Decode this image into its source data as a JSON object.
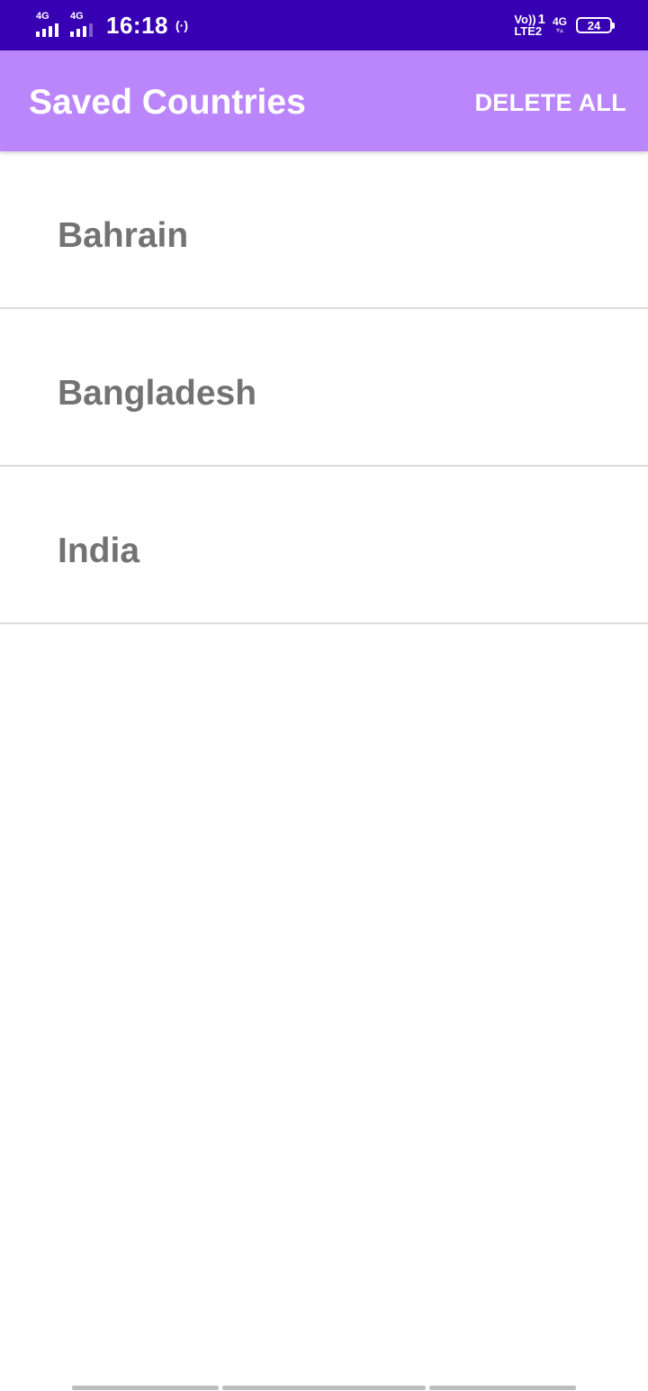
{
  "status_bar": {
    "sim1_network": "4G",
    "sim2_network": "4G",
    "time": "16:18",
    "hotspot_icon": "(·)",
    "volte_label": "Vo))",
    "volte_sim": "1",
    "lte_label": "LTE2",
    "mobile_data_network": "4G",
    "battery_level": "24"
  },
  "app_bar": {
    "title": "Saved Countries",
    "delete_all_label": "DELETE ALL",
    "background_color": "#bb86fc"
  },
  "countries": [
    {
      "name": "Bahrain"
    },
    {
      "name": "Bangladesh"
    },
    {
      "name": "India"
    }
  ],
  "colors": {
    "status_bar": "#3700b3",
    "app_bar": "#bb86fc",
    "item_text": "#737373",
    "divider": "#dcdcdc"
  }
}
